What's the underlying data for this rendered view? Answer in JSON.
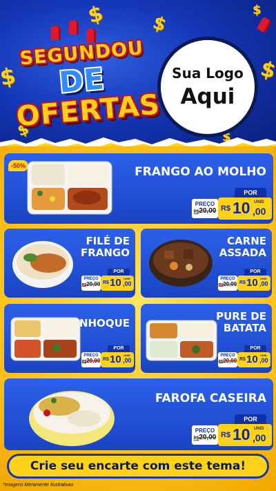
{
  "header": {
    "headline": [
      "SEGUNDOU",
      "DE",
      "OFERTAS"
    ],
    "logo_placeholder": [
      "Sua Logo",
      "Aqui"
    ]
  },
  "colors": {
    "primary_blue": "#1f4fd6",
    "accent_yellow": "#ffd21a",
    "strike_red": "#c1121f"
  },
  "products": [
    {
      "name": [
        "FRANGO AO MOLHO"
      ],
      "discount": "-50%",
      "por": "POR",
      "preco_label": "PREÇO",
      "old_prefix": "R$",
      "old_price": "20,00",
      "currency": "R$",
      "price_int": "10",
      "price_cents": ",00",
      "unit": "UNID",
      "icon": "meal-tray-chicken-sauce"
    },
    {
      "name": [
        "FILÉ DE",
        "FRANGO"
      ],
      "por": "POR",
      "preco_label": "PREÇO",
      "old_prefix": "R$",
      "old_price": "20,00",
      "currency": "R$",
      "price_int": "10",
      "price_cents": ",00",
      "unit": "UNID",
      "icon": "bowl-chicken-fillet"
    },
    {
      "name": [
        "CARNE",
        "ASSADA"
      ],
      "por": "POR",
      "preco_label": "PREÇO",
      "old_prefix": "R$",
      "old_price": "20,00",
      "currency": "R$",
      "price_int": "10",
      "price_cents": ",00",
      "unit": "UNID",
      "icon": "bowl-roast-beef"
    },
    {
      "name": [
        "NHOQUE"
      ],
      "por": "POR",
      "preco_label": "PREÇO",
      "old_prefix": "R$",
      "old_price": "20,00",
      "currency": "R$",
      "price_int": "10",
      "price_cents": ",00",
      "unit": "UNID",
      "icon": "meal-tray-gnocchi"
    },
    {
      "name": [
        "PURE DE",
        "BATATA"
      ],
      "por": "POR",
      "preco_label": "PREÇO",
      "old_prefix": "R$",
      "old_price": "20,00",
      "currency": "R$",
      "price_int": "10",
      "price_cents": ",00",
      "unit": "UNID",
      "icon": "meal-tray-mashed-potato"
    },
    {
      "name": [
        "FAROFA CASEIRA"
      ],
      "por": "POR",
      "preco_label": "PREÇO",
      "old_prefix": "R$",
      "old_price": "20,00",
      "currency": "R$",
      "price_int": "10",
      "price_cents": ",00",
      "unit": "UNID",
      "icon": "bowl-farofa"
    }
  ],
  "cta": "Crie seu encarte com este tema!",
  "footnote": "*Imagens Meramente Ilustrativas"
}
